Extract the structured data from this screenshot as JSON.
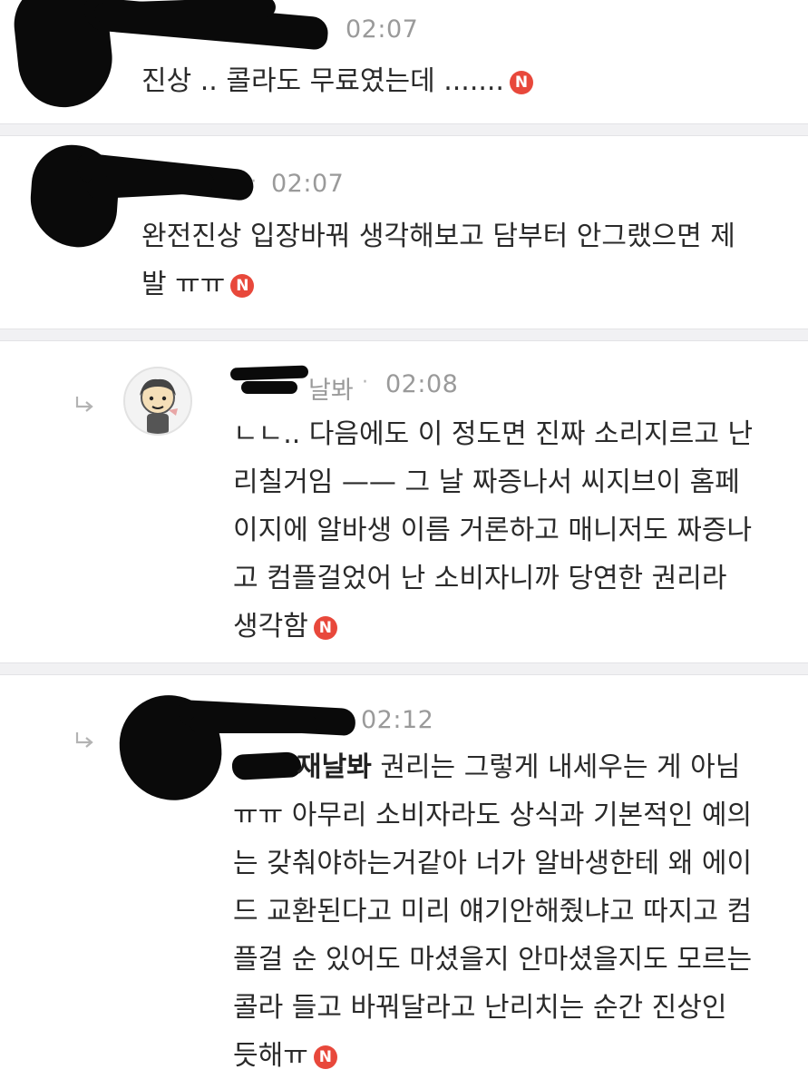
{
  "comments": [
    {
      "time": "02:07",
      "body": "진상 .. 콜라도 무료였는데 .......",
      "badge": "N"
    },
    {
      "time": "02:07",
      "body_line1": "완전진상 입장바꿔 생각해보고 담부터 안그랬으면 제",
      "body_line2": "발 ㅠㅠ",
      "badge": "N"
    },
    {
      "name_suffix": "날봐",
      "time": "02:08",
      "lines": [
        "ㄴㄴ.. 다음에도 이 정도면 진짜 소리지르고 난",
        "리칠거임 —— 그 날 짜증나서 씨지브이 홈페",
        "이지에 알바생 이름 거론하고 매니저도 짜증나",
        "고 컴플걸었어 난 소비자니까 당연한 권리라",
        "생각함"
      ],
      "badge": "N"
    },
    {
      "time": "02:12",
      "mention": "재날봐",
      "first_line": "권리는 그렇게 내세우는 게 아님",
      "lines": [
        "ㅠㅠ 아무리 소비자라도 상식과 기본적인 예의",
        "는 갖춰야하는거같아 너가 알바생한테 왜 에이",
        "드 교환된다고 미리 얘기안해줬냐고 따지고 컴",
        "플걸 순 있어도 마셨을지 안마셨을지도 모르는",
        "콜라 들고 바꿔달라고 난리치는 순간 진상인",
        "듯해ㅠ"
      ],
      "badge": "N"
    }
  ],
  "icons": {
    "reply": "reply-arrow-icon",
    "avatar": "default-profile-avatar",
    "new": "new-badge-icon"
  },
  "colors": {
    "badge": "#e8483b",
    "time": "#9a9a9a",
    "divider": "#f1f1f3"
  }
}
